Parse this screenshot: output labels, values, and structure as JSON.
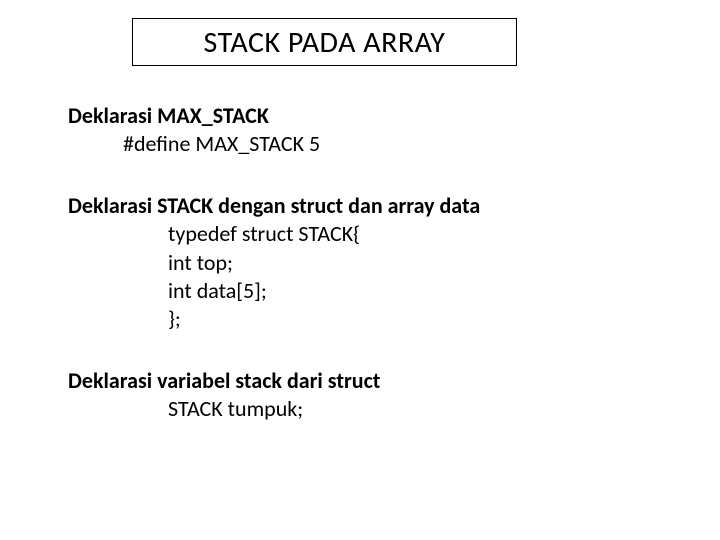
{
  "title": "STACK PADA ARRAY",
  "sections": {
    "s1": {
      "head": "Deklarasi MAX_STACK",
      "l1": "#define MAX_STACK 5"
    },
    "s2": {
      "head": "Deklarasi STACK dengan struct dan array data",
      "l1": "typedef struct STACK{",
      "l2": "int top;",
      "l3": "int data[5];",
      "l4": "};"
    },
    "s3": {
      "head": "Deklarasi variabel stack dari struct",
      "l1": "STACK tumpuk;"
    }
  }
}
